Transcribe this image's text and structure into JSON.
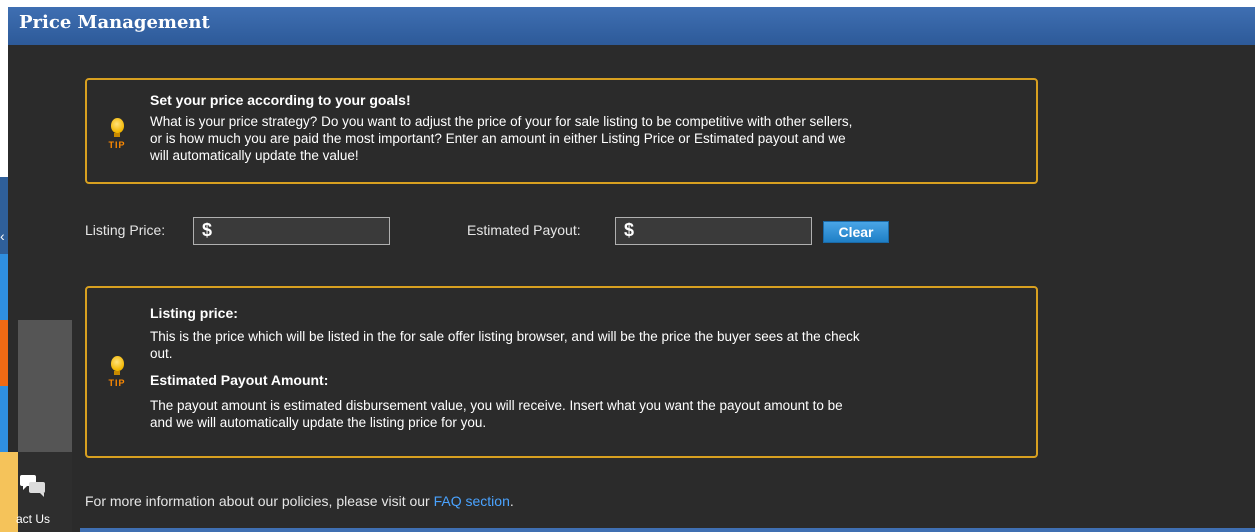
{
  "title": "Price Management",
  "tip_top": {
    "icon": "lightbulb-icon",
    "tip_label": "TIP",
    "heading": "Set your price according to your goals!",
    "lines": [
      "What is your price strategy? Do you want to adjust the price of your for sale listing to be competitive with other sellers,",
      "or is how much you are paid the most important? Enter an amount in either Listing Price or Estimated payout and we",
      "will automatically update the value!"
    ]
  },
  "form": {
    "listing_price_label": "Listing Price:",
    "listing_price_currency": "$",
    "listing_price_value": "",
    "estimated_payout_label": "Estimated Payout:",
    "estimated_payout_currency": "$",
    "estimated_payout_value": "",
    "clear_label": "Clear"
  },
  "tip_bottom": {
    "icon": "lightbulb-icon",
    "tip_label": "TIP",
    "listing_heading": "Listing price:",
    "listing_lines": [
      "This is the price which will be listed in the for sale offer listing browser, and will be the price the buyer sees at the check",
      "out."
    ],
    "payout_heading": "Estimated Payout Amount:",
    "payout_lines": [
      "The payout amount is estimated disbursement value, you will receive. Insert what you want the payout amount to be",
      "and we will automatically update the listing price for you."
    ]
  },
  "footer": {
    "text": "For more information about our policies, please visit our ",
    "link": "FAQ section",
    "suffix": "."
  },
  "sidebar": {
    "arrow": "‹",
    "contact_label": "act Us",
    "contact_icon": "chat-bubbles-icon"
  },
  "colors": {
    "titlebar": "#3f6fb2",
    "dialog_bg": "#2b2b2b",
    "tip_border": "#d8a020",
    "link": "#4aa3ff",
    "clear_button": "#1f7fc6",
    "tab_blue": "#2f8fe0",
    "tab_orange": "#f06a14",
    "tab_yellow": "#f5c35a"
  }
}
